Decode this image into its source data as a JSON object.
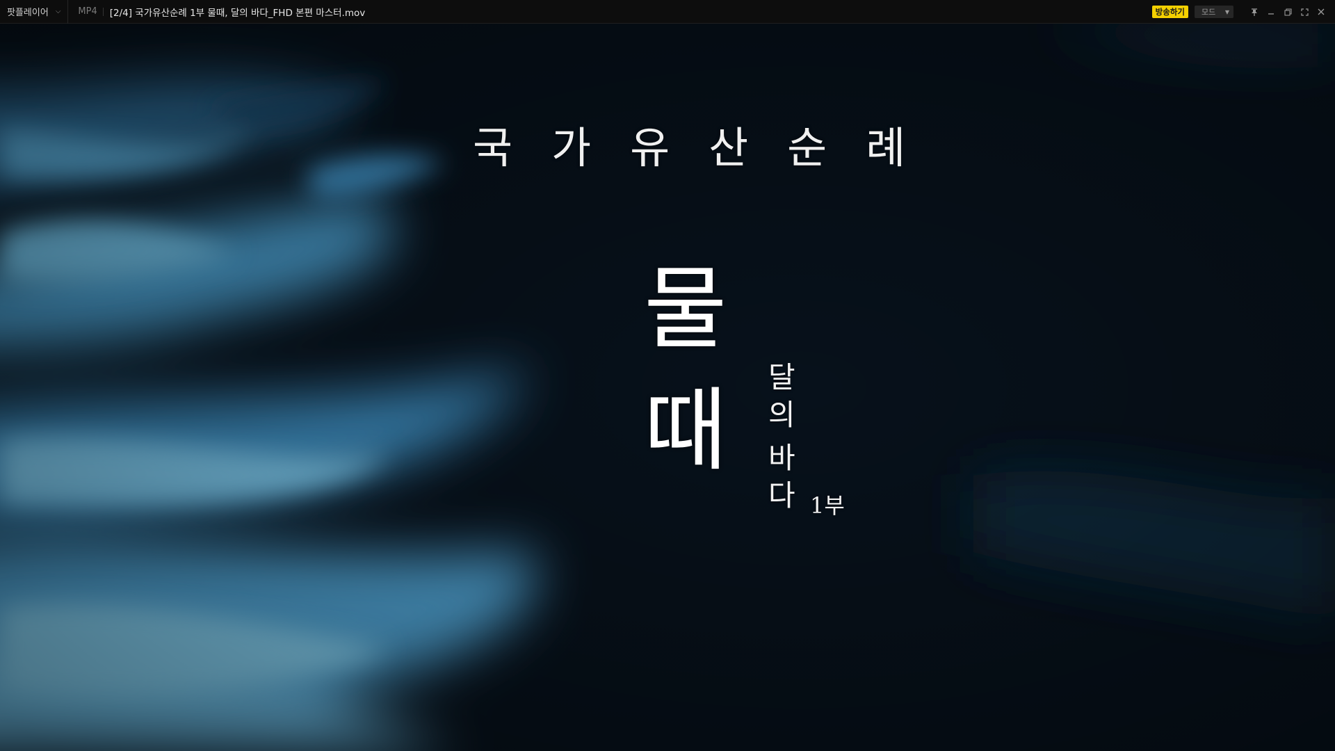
{
  "titlebar": {
    "app_name": "팟플레이어",
    "format": "MP4",
    "file_title": "[2/4] 국가유산순례 1부 물때, 달의 바다_FHD 본편 마스터.mov",
    "broadcast_label": "방송하기",
    "mode_label": "모드",
    "icons": {
      "app_menu": "chevron-down-icon",
      "mode": "caret-down-icon",
      "pin": "pin-icon",
      "minimize": "minimize-icon",
      "restore": "restore-icon",
      "fullscreen": "fullscreen-icon",
      "close": "close-icon"
    }
  },
  "video": {
    "series_title": "국가유산순례",
    "main_title_1": "물",
    "main_title_2": "때",
    "subtitle_1": "달",
    "subtitle_2": "의",
    "subtitle_3": "바",
    "subtitle_4": "다",
    "part": "1부"
  },
  "colors": {
    "titlebar_bg": "#0d0d0d",
    "broadcast_accent": "#f4d000",
    "video_dark": "#050a10",
    "water_blue": "#5fb6e0"
  }
}
